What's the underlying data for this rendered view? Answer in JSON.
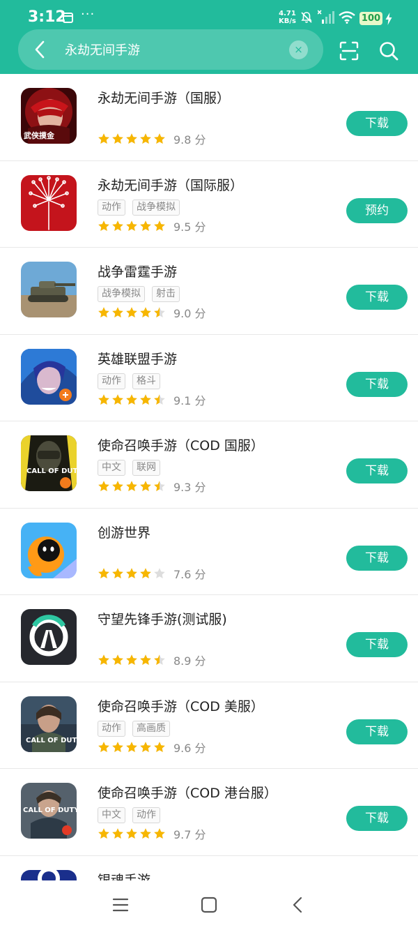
{
  "status_bar": {
    "time": "3:12",
    "dots": "···",
    "net_speed_value": "4.71",
    "net_speed_unit": "KB/s",
    "battery": "100",
    "icons": [
      "calendar-icon",
      "mute-icon",
      "signal-icon",
      "wifi-icon",
      "charging-icon"
    ]
  },
  "search": {
    "query": "永劫无间手游",
    "clear_icon": "×",
    "icons": [
      "back-icon",
      "clear-icon",
      "scan-icon",
      "search-icon"
    ]
  },
  "apps": [
    {
      "name": "永劫无间手游（国服）",
      "tags": [],
      "rating": 5,
      "score": "9.8 分",
      "action": "下载",
      "icon_text": "武侠摸金"
    },
    {
      "name": "永劫无间手游（国际服）",
      "tags": [
        "动作",
        "战争模拟"
      ],
      "rating": 5,
      "score": "9.5 分",
      "action": "预约"
    },
    {
      "name": "战争雷霆手游",
      "tags": [
        "战争模拟",
        "射击"
      ],
      "rating": 4.5,
      "score": "9.0 分",
      "action": "下载"
    },
    {
      "name": "英雄联盟手游",
      "tags": [
        "动作",
        "格斗"
      ],
      "rating": 4.5,
      "score": "9.1 分",
      "action": "下载"
    },
    {
      "name": "使命召唤手游（COD 国服）",
      "tags": [
        "中文",
        "联网"
      ],
      "rating": 4.5,
      "score": "9.3 分",
      "action": "下载",
      "icon_text": "CALL OF DUTY"
    },
    {
      "name": "创游世界",
      "tags": [],
      "rating": 4,
      "score": "7.6 分",
      "action": "下载"
    },
    {
      "name": "守望先锋手游(测试服)",
      "tags": [],
      "rating": 4.5,
      "score": "8.9 分",
      "action": "下载"
    },
    {
      "name": "使命召唤手游（COD 美服）",
      "tags": [
        "动作",
        "高画质"
      ],
      "rating": 5,
      "score": "9.6 分",
      "action": "下载",
      "icon_text": "CALL OF DUTY"
    },
    {
      "name": "使命召唤手游（COD 港台服）",
      "tags": [
        "中文",
        "动作"
      ],
      "rating": 5,
      "score": "9.7 分",
      "action": "下载",
      "icon_text": "CALL OF DUTY"
    },
    {
      "name": "银魂手游",
      "tags": [],
      "rating": 0,
      "score": "",
      "action": ""
    }
  ],
  "nav_bar": {
    "icons": [
      "menu-icon",
      "home-icon",
      "back-icon"
    ]
  },
  "colors": {
    "accent": "#22bb9c",
    "star": "#f7b600",
    "star_empty": "#dddddd"
  }
}
